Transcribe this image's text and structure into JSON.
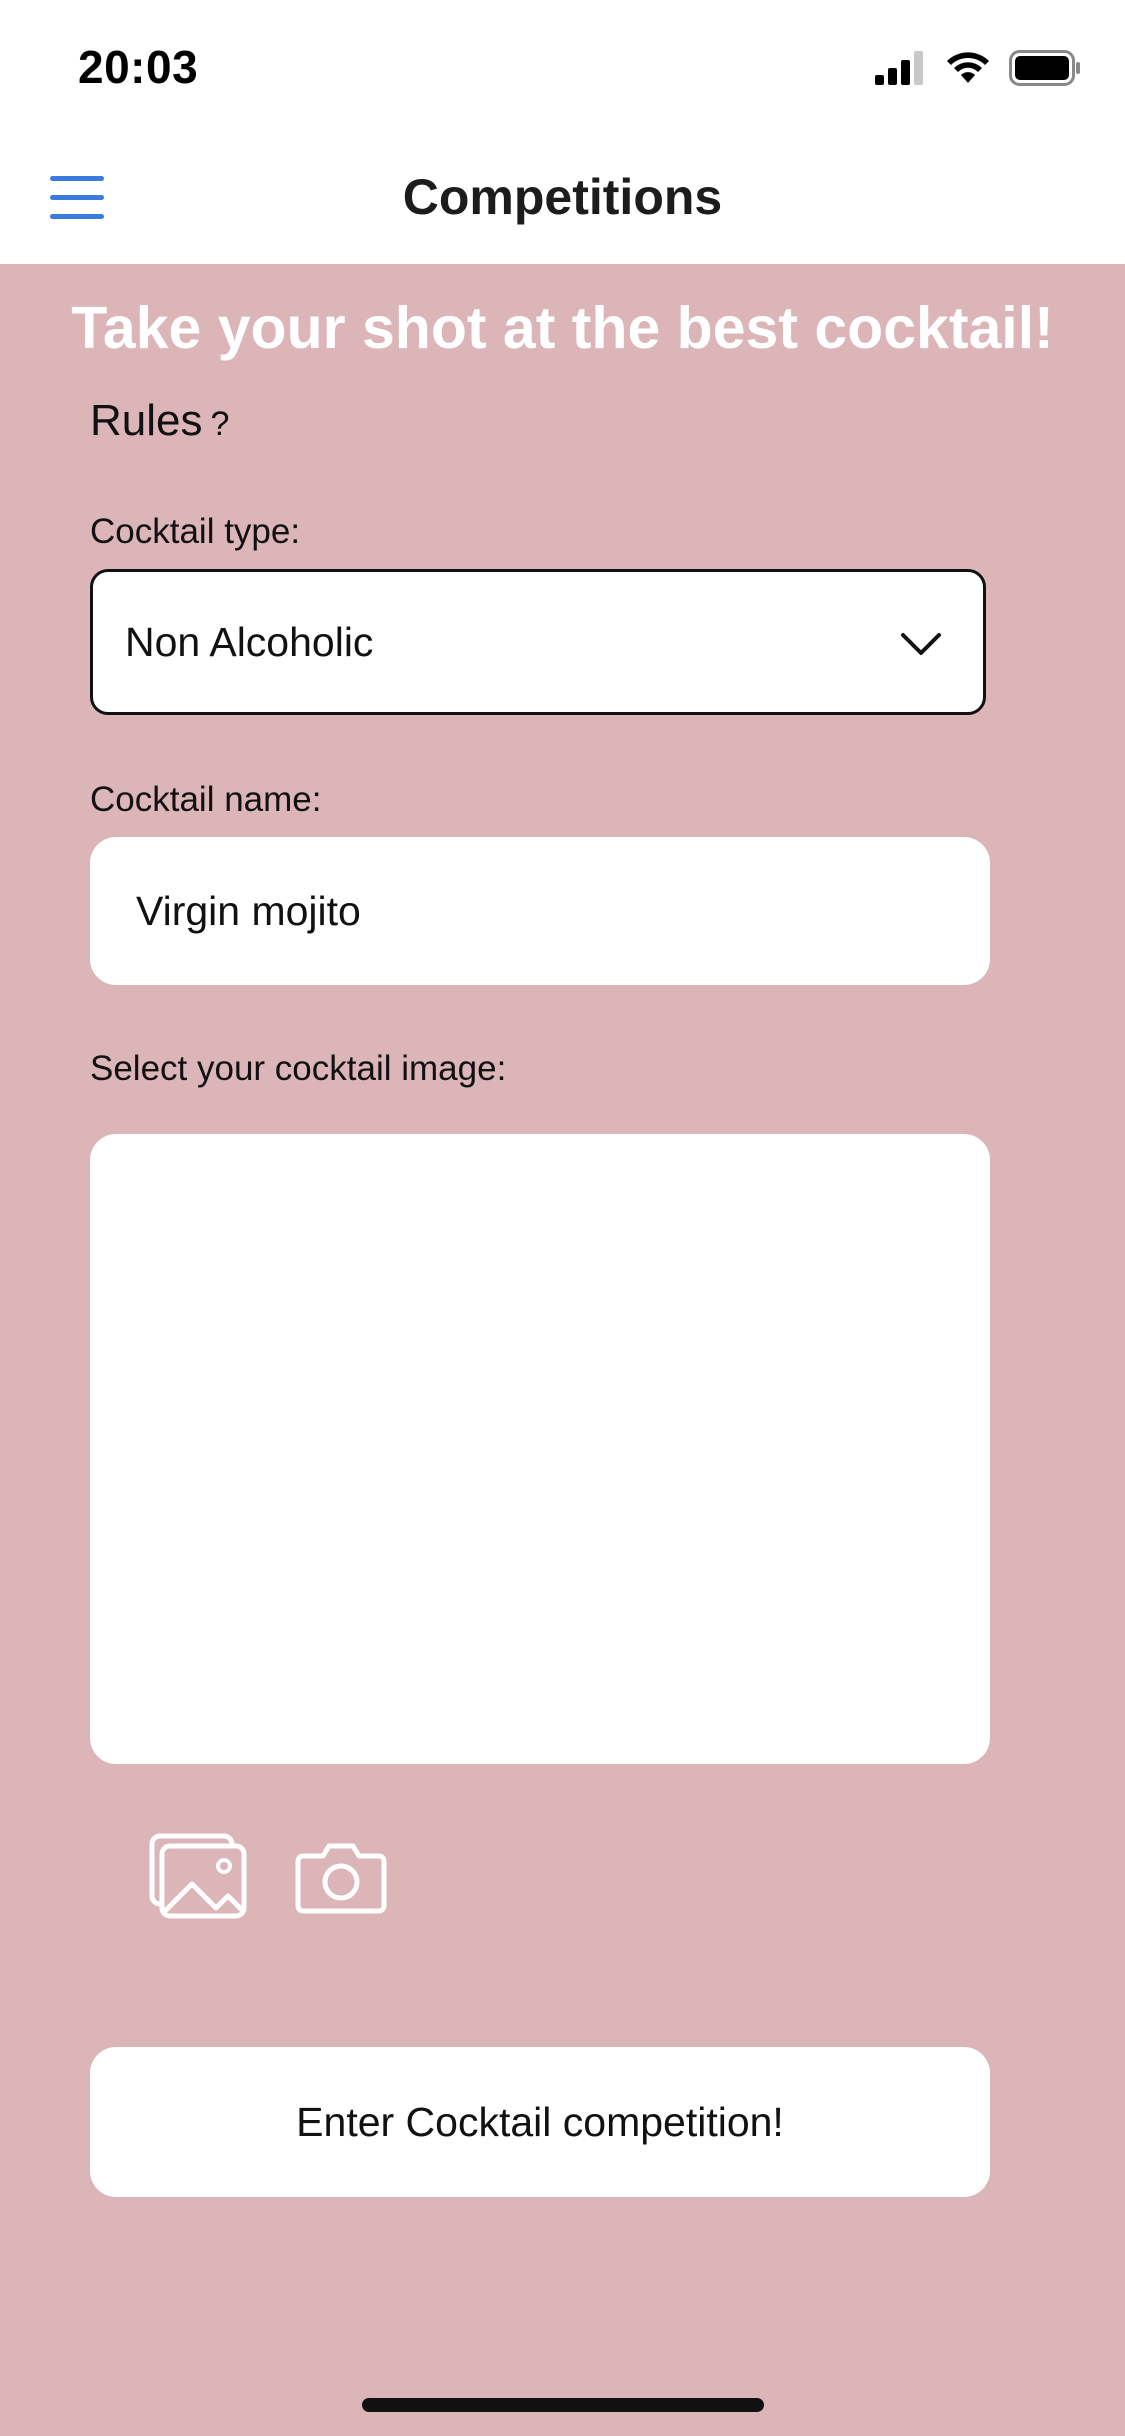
{
  "status_bar": {
    "time": "20:03"
  },
  "nav": {
    "title": "Competitions"
  },
  "banner": {
    "text": "Take your shot at the best cocktail!"
  },
  "rules": {
    "label": "Rules",
    "help": "?"
  },
  "form": {
    "cocktail_type_label": "Cocktail type:",
    "cocktail_type_value": "Non Alcoholic",
    "cocktail_name_label": "Cocktail name:",
    "cocktail_name_value": "Virgin mojito",
    "image_label": "Select your cocktail image:"
  },
  "buttons": {
    "enter_label": "Enter Cocktail competition!"
  },
  "icons": [
    "menu-icon",
    "chevron-down-icon",
    "gallery-icon",
    "camera-icon",
    "signal-icon",
    "wifi-icon",
    "battery-icon"
  ],
  "colors": {
    "background": "#dbb5b7",
    "accent": "#3b7be0",
    "surface": "#ffffff"
  }
}
